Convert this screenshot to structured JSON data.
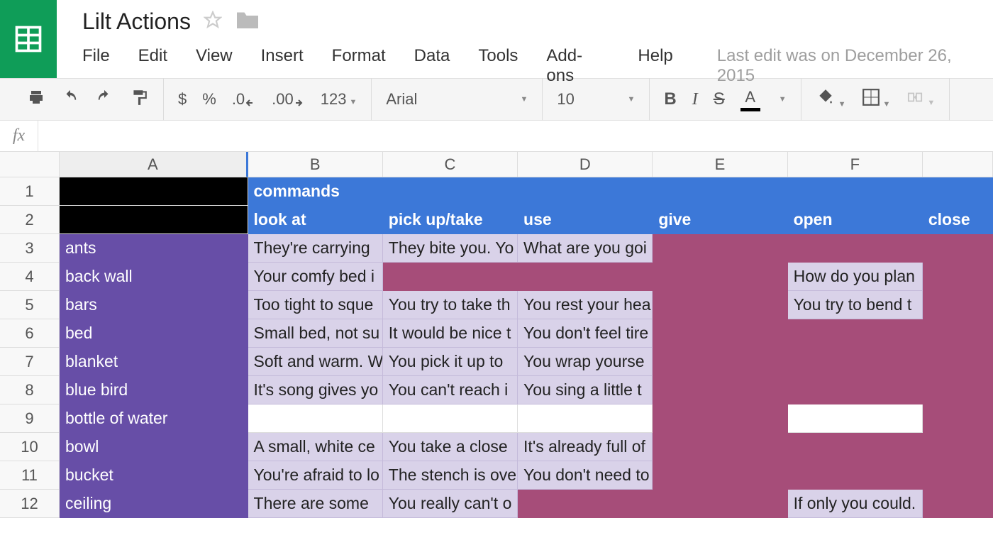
{
  "doc_title": "Lilt Actions",
  "menus": {
    "file": "File",
    "edit": "Edit",
    "view": "View",
    "insert": "Insert",
    "format": "Format",
    "data": "Data",
    "tools": "Tools",
    "addons": "Add-ons",
    "help": "Help"
  },
  "last_edit": "Last edit was on December 26, 2015",
  "toolbar": {
    "dollar": "$",
    "percent": "%",
    "dec_dec": ".0",
    "inc_dec": ".00",
    "fmt": "123",
    "font": "Arial",
    "size": "10",
    "bold": "B",
    "italic": "I",
    "strike": "S",
    "textcolor": "A"
  },
  "fx_label": "fx",
  "columns": [
    "A",
    "B",
    "C",
    "D",
    "E",
    "F",
    ""
  ],
  "row_numbers": [
    "1",
    "2",
    "3",
    "4",
    "5",
    "6",
    "7",
    "8",
    "9",
    "10",
    "11",
    "12"
  ],
  "header_row1": {
    "b": "commands"
  },
  "header_row2": {
    "b": "look at",
    "c": "pick up/take",
    "d": "use",
    "e": "give",
    "f": "open",
    "g": "close"
  },
  "objects": [
    "ants",
    "back wall",
    "bars",
    "bed",
    "blanket",
    "blue bird",
    "bottle of water",
    "bowl",
    "bucket",
    "ceiling"
  ],
  "cells": {
    "r3": {
      "b": "They're carrying",
      "c": "They bite you. Yo",
      "d": "What are you goi"
    },
    "r4": {
      "b": "Your comfy bed i",
      "f": "How do you plan"
    },
    "r5": {
      "b": "Too tight to sque",
      "c": "You try to take th",
      "d": "You rest your hea",
      "f": "You try to bend t"
    },
    "r6": {
      "b": "Small bed, not su",
      "c": "It would be nice t",
      "d": "You don't feel tire"
    },
    "r7": {
      "b": "Soft and warm. W",
      "c": "You pick it up to",
      "d": "You wrap yourse"
    },
    "r8": {
      "b": "It's song gives yo",
      "c": "You can't reach i",
      "d": "You sing a little t"
    },
    "r9": {},
    "r10": {
      "b": "A small, white ce",
      "c": "You take a close",
      "d": "It's already full of"
    },
    "r11": {
      "b": "You're afraid to lo",
      "c": "The stench is ove",
      "d": "You don't need to"
    },
    "r12": {
      "b": "There are some",
      "c": "You really can't o",
      "f": "If only you could."
    }
  }
}
